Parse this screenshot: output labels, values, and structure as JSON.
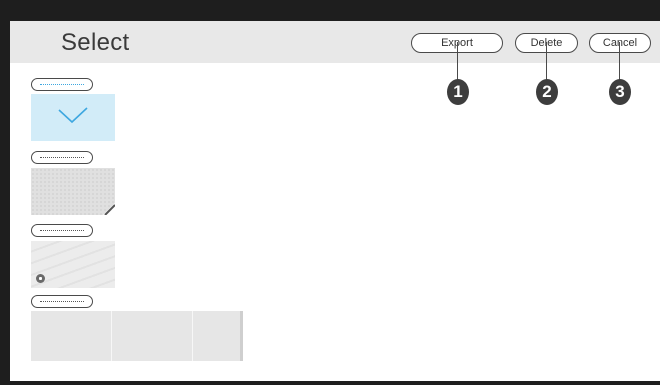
{
  "header": {
    "title": "Select",
    "buttons": {
      "export": "Export",
      "delete": "Delete",
      "cancel": "Cancel"
    }
  },
  "callouts": [
    "1",
    "2",
    "3"
  ],
  "content_items": [
    {
      "state": "selected",
      "icon": "check-icon"
    },
    {
      "state": "unselected",
      "icon": "corner-icon"
    },
    {
      "state": "unselected",
      "icon": "lock-icon"
    },
    {
      "state": "unselected",
      "icon": null
    }
  ],
  "colors": {
    "frame": "#1e1e1e",
    "header_bg": "#e8e8e8",
    "selected_bg": "#d2ecf8",
    "selected_accent": "#3da7e0",
    "callout_bg": "#3d3d3d"
  }
}
